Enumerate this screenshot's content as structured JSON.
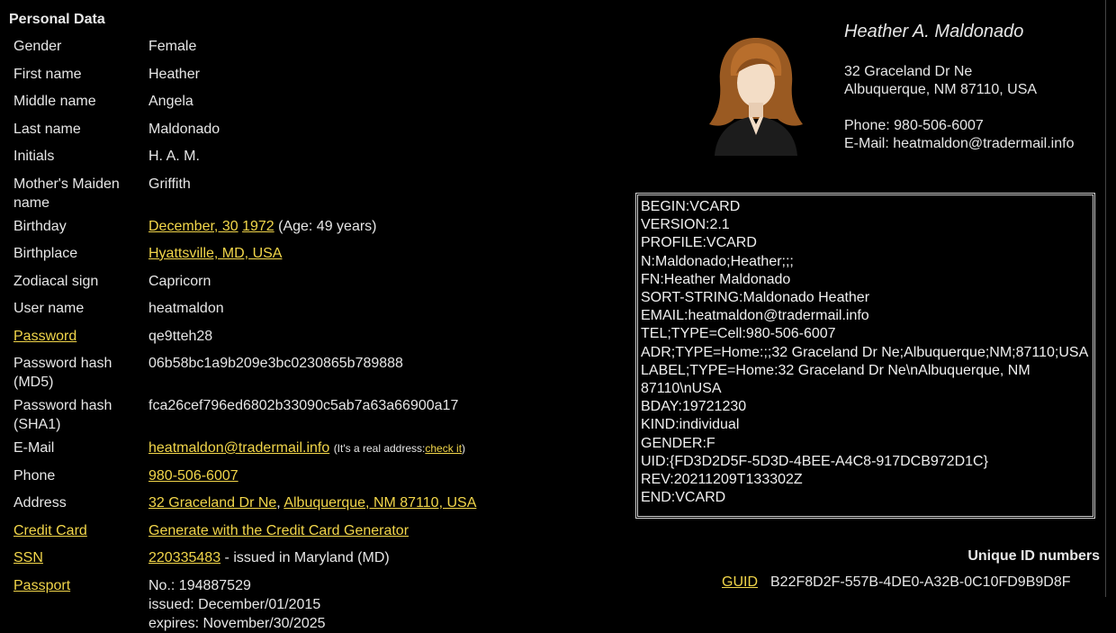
{
  "section_title": "Personal Data",
  "rows": [
    {
      "label": "Gender",
      "value": "Female"
    },
    {
      "label": "First name",
      "value": "Heather"
    },
    {
      "label": "Middle name",
      "value": "Angela"
    },
    {
      "label": "Last name",
      "value": "Maldonado"
    },
    {
      "label": "Initials",
      "value": "H. A. M."
    },
    {
      "label": "Mother's Maiden name",
      "value": "Griffith"
    }
  ],
  "birthday": {
    "label": "Birthday",
    "month_day": "December, 30",
    "year": "1972",
    "age": "(Age: 49 years)"
  },
  "birthplace": {
    "label": "Birthplace",
    "value": "Hyattsville, MD, USA"
  },
  "zodiac": {
    "label": "Zodiacal sign",
    "value": "Capricorn"
  },
  "username": {
    "label": "User name",
    "value": "heatmaldon"
  },
  "password": {
    "label": "Password",
    "value": "qe9tteh28"
  },
  "md5": {
    "label": "Password hash (MD5)",
    "value": "06b58bc1a9b209e3bc0230865b789888"
  },
  "sha1": {
    "label": "Password hash (SHA1)",
    "value": "fca26cef796ed6802b33090c5ab7a63a66900a17"
  },
  "email": {
    "label": "E-Mail",
    "value": "heatmaldon@tradermail.info",
    "note": "(It's a real address:",
    "check": "check it",
    "close": ")"
  },
  "phone": {
    "label": "Phone",
    "value": "980-506-6007"
  },
  "address": {
    "label": "Address",
    "street": "32 Graceland Dr Ne",
    "sep": ",",
    "city": "Albuquerque, NM 87110, USA"
  },
  "credit_card": {
    "label": "Credit Card",
    "value": "Generate with the Credit Card Generator"
  },
  "ssn": {
    "label": "SSN",
    "value": "220335483",
    "suffix": "- issued in Maryland (MD)"
  },
  "passport": {
    "label": "Passport",
    "no": "No.: 194887529",
    "issued": "issued: December/01/2015",
    "expires": "expires: November/30/2025"
  },
  "person": {
    "name": "Heather A. Maldonado",
    "address1": "32 Graceland Dr Ne",
    "address2": "Albuquerque, NM 87110, USA",
    "phone": "Phone: 980-506-6007",
    "email": "E-Mail: heatmaldon@tradermail.info"
  },
  "vcard_lines": [
    "BEGIN:VCARD",
    "VERSION:2.1",
    "PROFILE:VCARD",
    "N:Maldonado;Heather;;;",
    "FN:Heather Maldonado",
    "SORT-STRING:Maldonado Heather",
    "EMAIL:heatmaldon@tradermail.info",
    "TEL;TYPE=Cell:980-506-6007",
    "ADR;TYPE=Home:;;32 Graceland Dr Ne;Albuquerque;NM;87110;USA",
    "LABEL;TYPE=Home:32 Graceland Dr Ne\\nAlbuquerque, NM 87110\\nUSA",
    "BDAY:19721230",
    "KIND:individual",
    "GENDER:F",
    "UID:{FD3D2D5F-5D3D-4BEE-A4C8-917DCB972D1C}",
    "REV:20211209T133302Z",
    "END:VCARD"
  ],
  "unique_ids_title": "Unique ID numbers",
  "guid": {
    "label": "GUID",
    "value": "B22F8D2F-557B-4DE0-A32B-0C10FD9B9D8F"
  },
  "icons": {
    "avatar": "female-avatar-icon"
  },
  "colors": {
    "background": "#000000",
    "link": "#f2d64a",
    "text": "#e6e6e6"
  }
}
